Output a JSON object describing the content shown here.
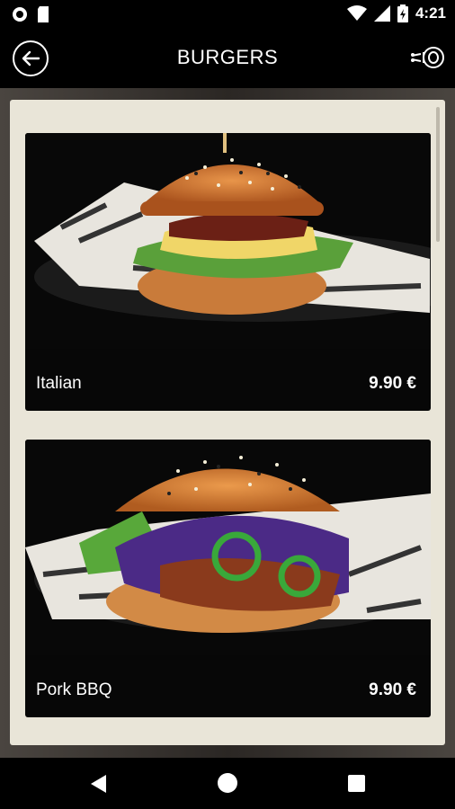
{
  "status_bar": {
    "time": "4:21",
    "icons": [
      "notification-circle-icon",
      "sd-card-icon",
      "wifi-icon",
      "signal-icon",
      "battery-icon"
    ]
  },
  "app_bar": {
    "title": "BURGERS",
    "back_icon": "back-arrow-icon",
    "cart_icon": "meat-icon"
  },
  "menu": {
    "items": [
      {
        "name": "Italian",
        "price": "9.90 €",
        "image": "italian-burger-photo"
      },
      {
        "name": "Pork BBQ",
        "price": "9.90 €",
        "image": "pork-bbq-burger-photo"
      }
    ]
  },
  "nav_bar": {
    "buttons": [
      "back-triangle-icon",
      "home-circle-icon",
      "recent-square-icon"
    ]
  },
  "colors": {
    "panel": "#e9e5d8",
    "card": "#070707",
    "bar": "#000000",
    "text": "#ffffff"
  }
}
